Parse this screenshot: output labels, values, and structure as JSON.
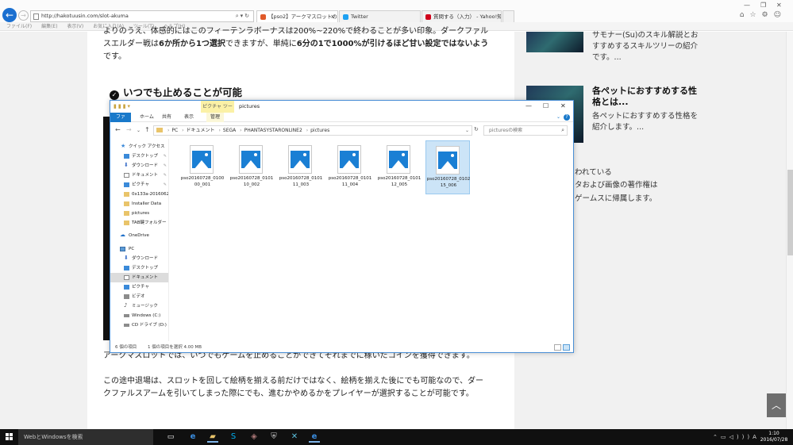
{
  "browser": {
    "url": "http://hakotuusin.com/slot-akuma",
    "tabs": [
      {
        "label": "【pso2】アークマスロットの攻略...",
        "active": true,
        "color": "#e05a2a"
      },
      {
        "label": "Twitter",
        "active": false,
        "color": "#1da1f2"
      },
      {
        "label": "質問する（入力） - Yahoo!知恵...",
        "active": false,
        "color": "#d0021b"
      }
    ],
    "menu": [
      "ファイル(F)",
      "編集(E)",
      "表示(V)",
      "お気に入り(A)",
      "ツール(T)",
      "ヘルプ(H)"
    ]
  },
  "article": {
    "top_line1": "よりのうえ、体感的にはこのフィーテンラボーナスは200%~220%で終わることが多い印象。ダークファル",
    "top_line2_pre": "スエルダー戦は",
    "top_line2_b1": "6か所から1つ選択",
    "top_line2_mid": "できますが、単純に",
    "top_line2_b2": "6分の1で1000%が引けるほど甘い設定ではないよう",
    "top_line3": "です。",
    "heading": "いつでも止めることが可能",
    "para1": "アークマスロットでは、いつでもゲームを止めることができてそれまでに稼いだコインを獲得できます。",
    "para2_line1": "この途中退場は、スロットを回して絵柄を揃える前だけではなく、絵柄を揃えた後にでも可能なので、ダー",
    "para2_line2": "クファルスアームを引いてしまった際にでも、進むかやめるかをプレイヤーが選択することが可能です。"
  },
  "sidebar": {
    "item1_desc": "サモナー(Su)のスキル解説とおすすめするスキルツリーの紹介です。...",
    "item2_title": "各ペットにおすすめする性格とは...",
    "item2_desc": "各ペットにおすすめする性格を紹介します。...",
    "copyright_line1": "われている",
    "copyright_line2": "タおよび画像の著作権は",
    "copyright_line3": "ゲームスに帰属します。"
  },
  "explorer": {
    "context_tab": "ピクチャ ツール",
    "title": "pictures",
    "ribbon_tabs": [
      "ファイル",
      "ホーム",
      "共有",
      "表示",
      "管理"
    ],
    "path": [
      "PC",
      "ドキュメント",
      "SEGA",
      "PHANTASYSTARONLINE2",
      "pictures"
    ],
    "search_placeholder": "picturesの検索",
    "nav": {
      "quick_access": "クイック アクセス",
      "qa_desktop": "デスクトップ",
      "qa_downloads": "ダウンロード",
      "qa_documents": "ドキュメント",
      "qa_pictures": "ピクチャ",
      "folder1": "0x133a-20160622",
      "folder2": "Installer Data",
      "folder3": "pictures",
      "folder4": "TAB鍵フォルダー",
      "onedrive": "OneDrive",
      "pc": "PC",
      "pc_downloads": "ダウンロード",
      "pc_desktop": "デスクトップ",
      "pc_documents": "ドキュメント",
      "pc_pictures": "ピクチャ",
      "pc_videos": "ビデオ",
      "pc_music": "ミュージック",
      "drive_c": "Windows (C:)",
      "drive_d": "CD ドライブ (D:) A"
    },
    "files": [
      {
        "name": "pso20160728_010000_001",
        "selected": false
      },
      {
        "name": "pso20160728_010110_002",
        "selected": false
      },
      {
        "name": "pso20160728_010111_003",
        "selected": false
      },
      {
        "name": "pso20160728_010111_004",
        "selected": false
      },
      {
        "name": "pso20160728_010112_005",
        "selected": false
      },
      {
        "name": "pso20160728_010215_006",
        "selected": true
      }
    ],
    "status_count": "6 個の項目",
    "status_selected": "1 個の項目を選択  4.00 MB"
  },
  "taskbar": {
    "search_placeholder": "WebとWindowsを検索",
    "ime": "A",
    "time": "1:10",
    "date": "2016/07/28"
  }
}
